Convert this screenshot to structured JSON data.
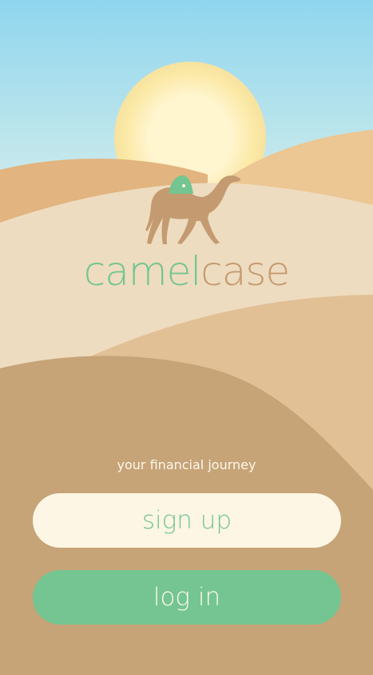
{
  "brand": {
    "name_part1": "camel",
    "name_part2": "case",
    "tagline": "your financial journey"
  },
  "actions": {
    "signup_label": "sign up",
    "login_label": "log in"
  },
  "colors": {
    "accent_green": "#74c591",
    "sand": "#c49b70",
    "cream": "#fdf6e4"
  }
}
